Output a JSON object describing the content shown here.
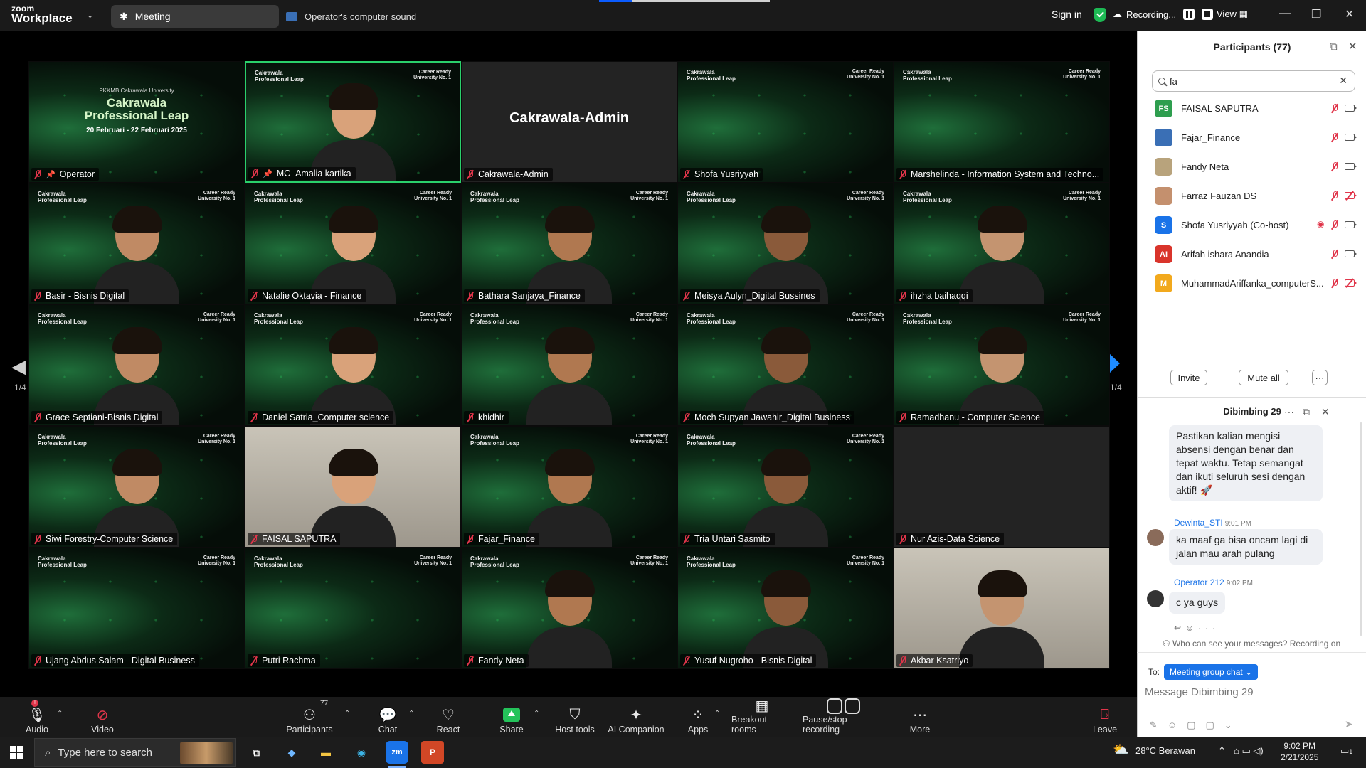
{
  "topbar": {
    "brand_small": "zoom",
    "brand_big": "Workplace",
    "meeting_tab": "Meeting",
    "sound_tab": "Operator's computer sound",
    "sign_in": "Sign in",
    "recording": "Recording...",
    "view": "View"
  },
  "gallery": {
    "page_left": "1/4",
    "page_right": "1/4",
    "brand_line1": "Cakrawala",
    "brand_line2": "Professional Leap",
    "brand_right": "Career Ready University No. 1",
    "operator_slide": {
      "line1": "PKKMB Cakrawala University",
      "line2": "Cakrawala",
      "line3": "Professional Leap",
      "line4": "20 Februari - 22 Februari 2025"
    },
    "admin_big": "Cakrawala-Admin",
    "tiles": [
      {
        "name": "Operator"
      },
      {
        "name": "MC- Amalia kartika"
      },
      {
        "name": "Cakrawala-Admin"
      },
      {
        "name": "Shofa Yusriyyah"
      },
      {
        "name": "Marshelinda - Information System and Techno..."
      },
      {
        "name": "Basir - Bisnis Digital"
      },
      {
        "name": "Natalie Oktavia - Finance"
      },
      {
        "name": "Bathara Sanjaya_Finance"
      },
      {
        "name": "Meisya Aulyn_Digital Bussines"
      },
      {
        "name": "ihzha baihaqqi"
      },
      {
        "name": "Grace Septiani-Bisnis Digital"
      },
      {
        "name": "Daniel Satria_Computer science"
      },
      {
        "name": "khidhir"
      },
      {
        "name": "Moch Supyan Jawahir_Digital Business"
      },
      {
        "name": "Ramadhanu - Computer Science"
      },
      {
        "name": "Siwi Forestry-Computer Science"
      },
      {
        "name": "FAISAL SAPUTRA"
      },
      {
        "name": "Fajar_Finance"
      },
      {
        "name": "Tria Untari Sasmito"
      },
      {
        "name": "Nur Azis-Data Science"
      },
      {
        "name": "Ujang Abdus Salam - Digital Business"
      },
      {
        "name": "Putri Rachma"
      },
      {
        "name": "Fandy Neta"
      },
      {
        "name": "Yusuf Nugroho - Bisnis Digital"
      },
      {
        "name": "Akbar Ksatriyo"
      }
    ]
  },
  "participants": {
    "title": "Participants (77)",
    "search_value": "fa",
    "items": [
      {
        "initials": "FS",
        "name": "FAISAL SAPUTRA",
        "color": "#2e9e4f"
      },
      {
        "initials": "",
        "name": "Fajar_Finance",
        "color": "#3a6fb5"
      },
      {
        "initials": "",
        "name": "Fandy Neta",
        "color": "#b8a37c"
      },
      {
        "initials": "",
        "name": "Farraz Fauzan DS",
        "color": "#c4906e"
      },
      {
        "initials": "S",
        "name": "Shofa Yusriyyah (Co-host)",
        "color": "#1a73e8"
      },
      {
        "initials": "AI",
        "name": "Arifah ishara Anandia",
        "color": "#d9342b"
      },
      {
        "initials": "M",
        "name": "MuhammadAriffanka_computerS...",
        "color": "#f2a91d"
      }
    ],
    "invite": "Invite",
    "mute_all": "Mute all",
    "more": "···"
  },
  "chat": {
    "title": "Dibimbing 29",
    "messages": [
      {
        "text": "Pastikan kalian mengisi absensi dengan benar dan tepat waktu. Tetap semangat dan ikuti seluruh sesi dengan aktif! 🚀"
      },
      {
        "sender": "Dewinta_STI",
        "time": "9:01 PM",
        "text": "ka maaf ga bisa oncam lagi di jalan mau arah pulang"
      },
      {
        "sender": "Operator 212",
        "time": "9:02 PM",
        "text": "c ya guys"
      }
    ],
    "visibility": "Who can see your messages? Recording on",
    "to_label": "To:",
    "to_target": "Meeting group chat ⌄",
    "compose_placeholder": "Message Dibimbing 29"
  },
  "toolbar": {
    "audio": "Audio",
    "video": "Video",
    "participants": "Participants",
    "participants_count": "77",
    "chat": "Chat",
    "react": "React",
    "share": "Share",
    "host_tools": "Host tools",
    "ai_companion": "AI Companion",
    "apps": "Apps",
    "breakout": "Breakout rooms",
    "pause_rec": "Pause/stop recording",
    "more": "More",
    "leave": "Leave"
  },
  "taskbar": {
    "search_placeholder": "Type here to search",
    "weather": "28°C  Berawan",
    "time": "9:02 PM",
    "date": "2/21/2025",
    "notif_count": "1"
  }
}
